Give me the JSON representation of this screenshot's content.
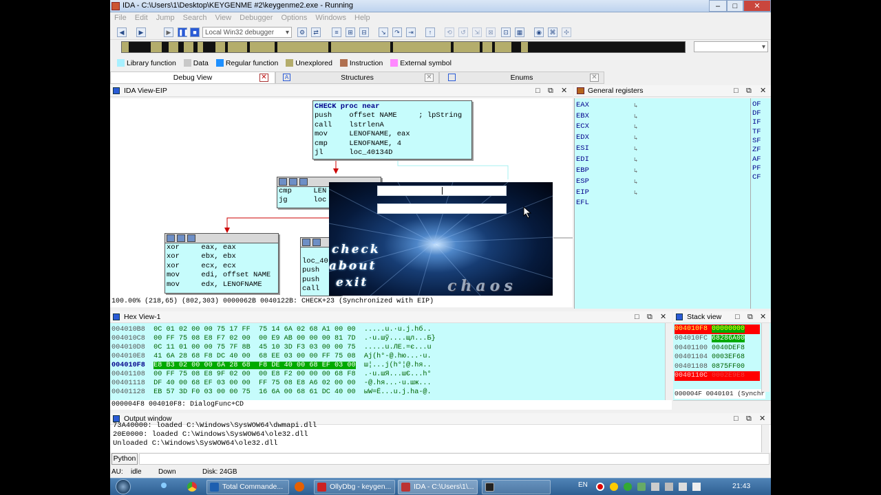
{
  "window": {
    "title": "IDA - C:\\Users\\1\\Desktop\\KEYGENME #2\\keygenme2.exe - Running",
    "min": "–",
    "max": "□",
    "close": "✕"
  },
  "menu": [
    "File",
    "Edit",
    "Jump",
    "Search",
    "View",
    "Debugger",
    "Options",
    "Windows",
    "Help"
  ],
  "toolbar": {
    "debugger_select": "Local Win32 debugger",
    "nav_dropdown": ""
  },
  "legend": [
    {
      "label": "Library function",
      "color": "#a8f0ff"
    },
    {
      "label": "Data",
      "color": "#c8c8c8"
    },
    {
      "label": "Regular function",
      "color": "#1e90ff"
    },
    {
      "label": "Unexplored",
      "color": "#b4ad6c"
    },
    {
      "label": "Instruction",
      "color": "#b07050"
    },
    {
      "label": "External symbol",
      "color": "#ff88ff"
    }
  ],
  "tabs": [
    "Debug View",
    "Structures",
    "Enums"
  ],
  "ida_view": {
    "title": "IDA View-EIP",
    "node_main": [
      "CHECK proc near",
      "push    offset NAME     ; lpString",
      "call    lstrlenA",
      "mov     LENOFNAME, eax",
      "cmp     LENOFNAME, 4",
      "jl      loc_40134D"
    ],
    "node_cmp": [
      "cmp     LEN",
      "jg      loc"
    ],
    "node_left": [
      "xor     eax, eax",
      "xor     ebx, ebx",
      "xor     ecx, ecx",
      "mov     edi, offset NAME",
      "mov     edx, LENOFNAME"
    ],
    "node_right": [
      "loc_40",
      "push",
      "push",
      "call"
    ],
    "status": "100.00% (218,65) (802,303) 0000062B 0040122B: CHECK+23 (Synchronized with EIP)"
  },
  "keygen": {
    "buttons": [
      "check",
      "about",
      "exit"
    ],
    "logo": "chaos"
  },
  "registers": {
    "title": "General registers",
    "names": [
      "EAX",
      "EBX",
      "ECX",
      "EDX",
      "ESI",
      "EDI",
      "EBP",
      "ESP",
      "EIP",
      "EFL"
    ],
    "flags": [
      "OF",
      "DF",
      "IF",
      "TF",
      "SF",
      "ZF",
      "AF",
      "PF",
      "CF"
    ]
  },
  "hex_view": {
    "title": "Hex View-1",
    "rows": [
      {
        "addr": "004010B8",
        "bytes": "0C 01 02 00 00 75 17 FF  75 14 6A 02 68 A1 00 00",
        "ascii": ".....u.·u.j.hб.."
      },
      {
        "addr": "004010C8",
        "bytes": "00 FF 75 08 E8 F7 02 00  00 E9 AB 00 00 00 81 7D",
        "ascii": ".·u.шў....щл...Б}"
      },
      {
        "addr": "004010D8",
        "bytes": "0C 11 01 00 00 75 7F 8B  45 10 3D F3 03 00 00 75",
        "ascii": ".....u.ЛE.=є...u"
      },
      {
        "addr": "004010E8",
        "bytes": "41 6A 28 68 F8 DC 40 00  68 EE 03 00 00 FF 75 08",
        "ascii": "Aj(h°-@.hю...·u."
      },
      {
        "addr": "004010F8",
        "bytes": "E8 B3 02 00 00 6A 28 68  F8 DE 40 00 68 EF 03 00",
        "ascii": "ш¦...j(h°¦@.hя.."
      },
      {
        "addr": "00401108",
        "bytes": "00 FF 75 08 E8 9F 02 00  00 E8 F2 00 00 00 68 F8",
        "ascii": ".·u.шЯ...шЄ...h°"
      },
      {
        "addr": "00401118",
        "bytes": "DF 40 00 68 EF 03 00 00  FF 75 08 E8 A6 02 00 00",
        "ascii": "-@.hя...·u.шж..."
      },
      {
        "addr": "00401128",
        "bytes": "EB 57 3D F0 03 00 00 75  16 6A 00 68 61 DC 40 00",
        "ascii": "ыW=Ё...u.j.ha-@."
      }
    ],
    "status": "000004F8 004010F8: DialogFunc+CD"
  },
  "stack_view": {
    "title": "Stack view",
    "rows": [
      {
        "addr": "004010F8",
        "val": "00000000"
      },
      {
        "addr": "004010FC",
        "val": "68286A00"
      },
      {
        "addr": "00401100",
        "val": "0040DEF8"
      },
      {
        "addr": "00401104",
        "val": "0003EF68"
      },
      {
        "addr": "00401108",
        "val": "0875FF00"
      },
      {
        "addr": "0040110C",
        "val": "0002E9E8"
      }
    ],
    "status": "000004F 0040101 (Synchr"
  },
  "output": {
    "title": "Output window",
    "lines": [
      "73A40000: loaded C:\\Windows\\SysWOW64\\dwmapi.dll",
      "20E0000: loaded C:\\Windows\\SysWOW64\\ole32.dll",
      "Unloaded C:\\Windows\\SysWOW64\\ole32.dll"
    ],
    "python_button": "Python"
  },
  "statusbar": {
    "au": "AU:",
    "state": "idle",
    "dir": "Down",
    "disk": "Disk: 24GB"
  },
  "taskbar": {
    "items": [
      "Total Commande...",
      "OllyDbg - keygen...",
      "IDA - C:\\Users\\1\\..."
    ],
    "lang": "EN",
    "time": "21:43"
  }
}
